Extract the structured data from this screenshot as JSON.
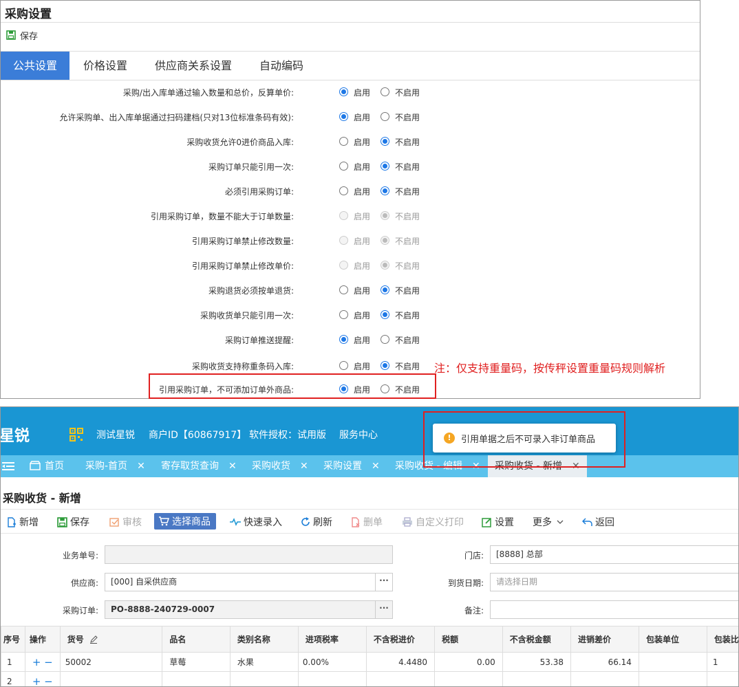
{
  "settings": {
    "title": "采购设置",
    "save_label": "保存",
    "tabs": [
      "公共设置",
      "价格设置",
      "供应商关系设置",
      "自动编码"
    ],
    "enable_label": "启用",
    "disable_label": "不启用",
    "rows": [
      {
        "label": "采购/出入库单通过输入数量和总价，反算单价:",
        "value": "enable",
        "disabled": false
      },
      {
        "label": "允许采购单、出入库单据通过扫码建档(只对13位标准条码有效):",
        "value": "enable",
        "disabled": false
      },
      {
        "label": "采购收货允许0进价商品入库:",
        "value": "disable",
        "disabled": false
      },
      {
        "label": "采购订单只能引用一次:",
        "value": "disable",
        "disabled": false
      },
      {
        "label": "必须引用采购订单:",
        "value": "disable",
        "disabled": false
      },
      {
        "label": "引用采购订单，数量不能大于订单数量:",
        "value": "disable",
        "disabled": true
      },
      {
        "label": "引用采购订单禁止修改数量:",
        "value": "disable",
        "disabled": true
      },
      {
        "label": "引用采购订单禁止修改单价:",
        "value": "disable",
        "disabled": true
      },
      {
        "label": "采购退货必须按单退货:",
        "value": "disable",
        "disabled": false
      },
      {
        "label": "采购收货单只能引用一次:",
        "value": "disable",
        "disabled": false
      },
      {
        "label": "采购订单推送提醒:",
        "value": "enable",
        "disabled": false
      },
      {
        "label": "采购收货支持称重条码入库:",
        "value": "disable",
        "disabled": false
      },
      {
        "label": "引用采购订单，不可添加订单外商品:",
        "value": "enable",
        "disabled": false
      }
    ],
    "note": "注：仅支持重量码，按传秤设置重量码规则解析"
  },
  "app": {
    "brand": "星锐",
    "store_name": "测试星锐",
    "merchant_id": "商户ID【60867917】",
    "license": "软件授权：试用版",
    "service": "服务中心",
    "toast": "引用单据之后不可录入非订单商品",
    "tabs": [
      {
        "label": "首页",
        "closable": false
      },
      {
        "label": "采购-首页",
        "closable": true
      },
      {
        "label": "寄存取货查询",
        "closable": true
      },
      {
        "label": "采购收货",
        "closable": true
      },
      {
        "label": "采购设置",
        "closable": true
      },
      {
        "label": "采购收货 - 编辑",
        "closable": true
      },
      {
        "label": "采购收货 - 新增",
        "closable": true,
        "active": true
      }
    ],
    "page_title": "采购收货 - 新增",
    "toolbar": {
      "new": "新增",
      "save": "保存",
      "audit": "审核",
      "select": "选择商品",
      "quick": "快速录入",
      "refresh": "刷新",
      "delete": "删单",
      "print": "自定义打印",
      "settings": "设置",
      "more": "更多",
      "back": "返回"
    },
    "form": {
      "biz_no_label": "业务单号:",
      "biz_no": "",
      "store_label": "门店:",
      "store": "[8888] 总部",
      "supplier_label": "供应商:",
      "supplier": "[000] 自采供应商",
      "arrival_label": "到货日期:",
      "arrival_placeholder": "请选择日期",
      "order_label": "采购订单:",
      "order": "PO-8888-240729-0007",
      "remark_label": "备注:",
      "remark": "",
      "dots": "···"
    },
    "grid": {
      "headers": [
        "序号",
        "操作",
        "货号",
        "品名",
        "类别名称",
        "进项税率",
        "不含税进价",
        "税额",
        "不含税金额",
        "进销差价",
        "包装单位",
        "包装比"
      ],
      "rows": [
        {
          "no": "1",
          "ops": "+ −",
          "code": "50002",
          "name": "草莓",
          "category": "水果",
          "tax_rate": "0.00%",
          "price": "4.4480",
          "tax": "0.00",
          "amount": "53.38",
          "diff": "66.14",
          "unit": "",
          "ratio": "1"
        },
        {
          "no": "2",
          "ops": "+ −",
          "code": "",
          "name": "",
          "category": "",
          "tax_rate": "",
          "price": "",
          "tax": "",
          "amount": "",
          "diff": "",
          "unit": "",
          "ratio": ""
        }
      ]
    }
  }
}
